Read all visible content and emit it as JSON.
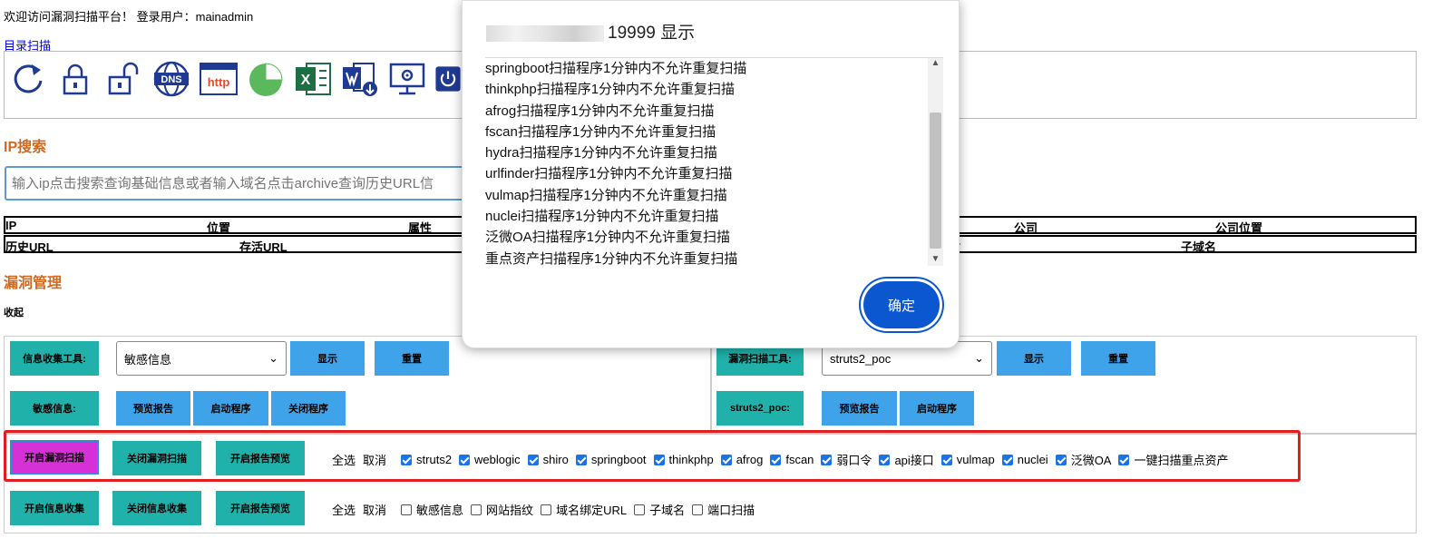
{
  "header": {
    "welcome": "欢迎访问漏洞扫描平台！ 登录用户：mainadmin",
    "dir_scan_link": "目录扫描"
  },
  "toolbar_icons": [
    "refresh-icon",
    "unlock-icon",
    "lock-icon",
    "dns-icon",
    "http-icon",
    "pie-chart-icon",
    "excel-icon",
    "word-download-icon",
    "monitor-settings-icon",
    "power-icon"
  ],
  "icon_labels": {
    "dns": "DNS",
    "http": "http",
    "excel": "X"
  },
  "ip_search": {
    "title": "IP搜索",
    "placeholder": "输入ip点击搜索查询基础信息或者输入域名点击archive查询历史URL信"
  },
  "table1": {
    "headers": [
      "IP",
      "位置",
      "属性",
      "公司",
      "公司位置"
    ]
  },
  "table2": {
    "headers": [
      "历史URL",
      "存活URL",
      "敏",
      "子域名"
    ]
  },
  "vuln": {
    "title": "漏洞管理",
    "collapse": "收起"
  },
  "left_panel": {
    "tool_label": "信息收集工具:",
    "select_value": "敏感信息",
    "show": "显示",
    "reset": "重置",
    "sensitive_label": "敏感信息:",
    "preview_report": "预览报告",
    "start_program": "启动程序",
    "stop_program": "关闭程序"
  },
  "right_panel": {
    "tool_label": "漏洞扫描工具:",
    "select_value": "struts2_poc",
    "show": "显示",
    "reset": "重置",
    "poc_label": "struts2_poc:",
    "preview_report": "预览报告",
    "start_program": "启动程序"
  },
  "vuln_row": {
    "start": "开启漏洞扫描",
    "stop": "关闭漏洞扫描",
    "report": "开启报告预览",
    "select_all": "全选",
    "cancel": "取消",
    "options": [
      {
        "label": "struts2",
        "checked": true
      },
      {
        "label": "weblogic",
        "checked": true
      },
      {
        "label": "shiro",
        "checked": true
      },
      {
        "label": "springboot",
        "checked": true
      },
      {
        "label": "thinkphp",
        "checked": true
      },
      {
        "label": "afrog",
        "checked": true
      },
      {
        "label": "fscan",
        "checked": true
      },
      {
        "label": "弱口令",
        "checked": true
      },
      {
        "label": "api接口",
        "checked": true
      },
      {
        "label": "vulmap",
        "checked": true
      },
      {
        "label": "nuclei",
        "checked": true
      },
      {
        "label": "泛微OA",
        "checked": true
      },
      {
        "label": "一键扫描重点资产",
        "checked": true
      }
    ]
  },
  "info_row": {
    "start": "开启信息收集",
    "stop": "关闭信息收集",
    "report": "开启报告预览",
    "select_all": "全选",
    "cancel": "取消",
    "options": [
      {
        "label": "敏感信息",
        "checked": false
      },
      {
        "label": "网站指纹",
        "checked": false
      },
      {
        "label": "域名绑定URL",
        "checked": false
      },
      {
        "label": "子域名",
        "checked": false
      },
      {
        "label": "端口扫描",
        "checked": false
      }
    ]
  },
  "dialog": {
    "title_suffix": "19999 显示",
    "messages": [
      "springboot扫描程序1分钟内不允许重复扫描",
      "thinkphp扫描程序1分钟内不允许重复扫描",
      "afrog扫描程序1分钟内不允许重复扫描",
      "fscan扫描程序1分钟内不允许重复扫描",
      "hydra扫描程序1分钟内不允许重复扫描",
      "urlfinder扫描程序1分钟内不允许重复扫描",
      "vulmap扫描程序1分钟内不允许重复扫描",
      "nuclei扫描程序1分钟内不允许重复扫描",
      "泛微OA扫描程序1分钟内不允许重复扫描",
      "重点资产扫描程序1分钟内不允许重复扫描"
    ],
    "ok": "确定"
  },
  "colors": {
    "accent_orange": "#d2691e",
    "teal": "#20b2aa",
    "blue": "#3ea3e8",
    "magenta": "#d631d6",
    "highlight_red": "#e02020",
    "dialog_ok": "#0b57d0"
  }
}
